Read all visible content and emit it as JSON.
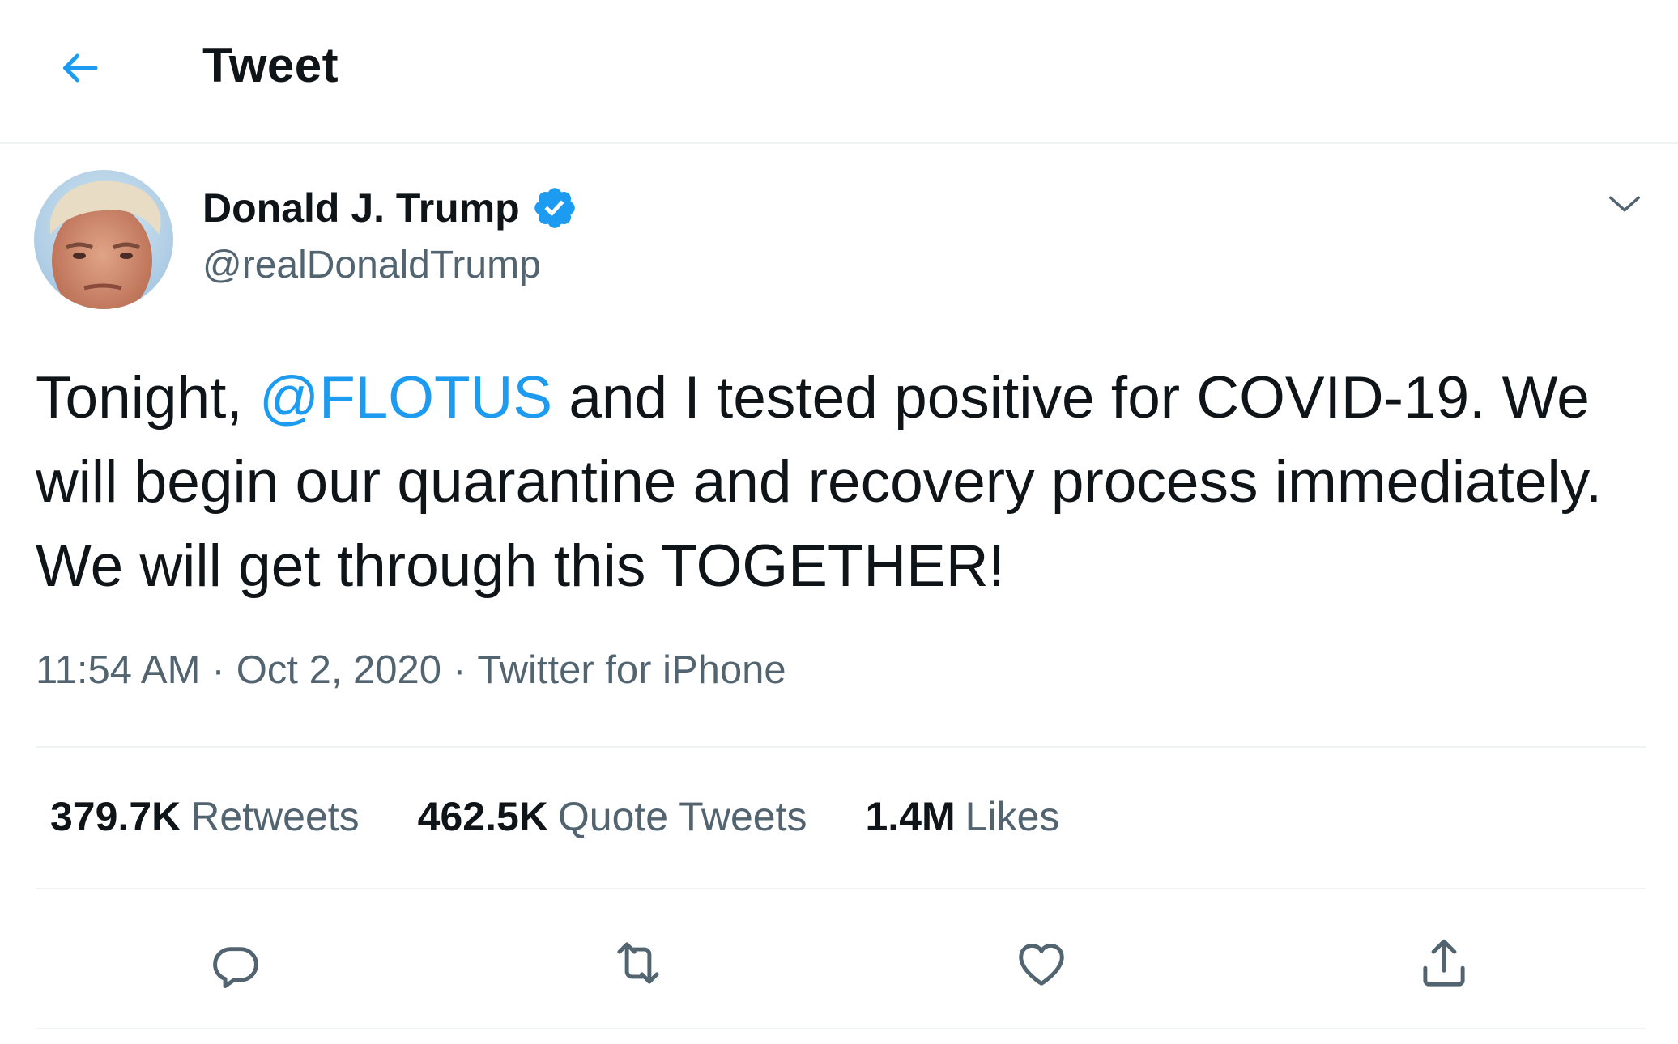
{
  "header": {
    "title": "Tweet",
    "back_icon": "arrow-left-icon"
  },
  "tweet": {
    "author": {
      "name": "Donald J. Trump",
      "handle": "@realDonaldTrump",
      "verified": true
    },
    "text_parts": {
      "before": "Tonight, ",
      "mention": "@FLOTUS",
      "after": " and I tested positive for COVID-19. We will begin our quarantine and recovery process immediately. We will get through this TOGETHER!"
    },
    "meta": {
      "time": "11:54 AM",
      "date": "Oct 2, 2020",
      "source": "Twitter for iPhone",
      "sep1": "·",
      "sep2": "·"
    },
    "stats": [
      {
        "value": "379.7K",
        "label": "Retweets"
      },
      {
        "value": "462.5K",
        "label": "Quote Tweets"
      },
      {
        "value": "1.4M",
        "label": "Likes"
      }
    ],
    "actions": [
      "reply-icon",
      "retweet-icon",
      "like-icon",
      "share-icon"
    ]
  },
  "colors": {
    "accent": "#1d9bf0",
    "text": "#0f1419",
    "secondary": "#536471",
    "divider": "#eff3f4"
  }
}
